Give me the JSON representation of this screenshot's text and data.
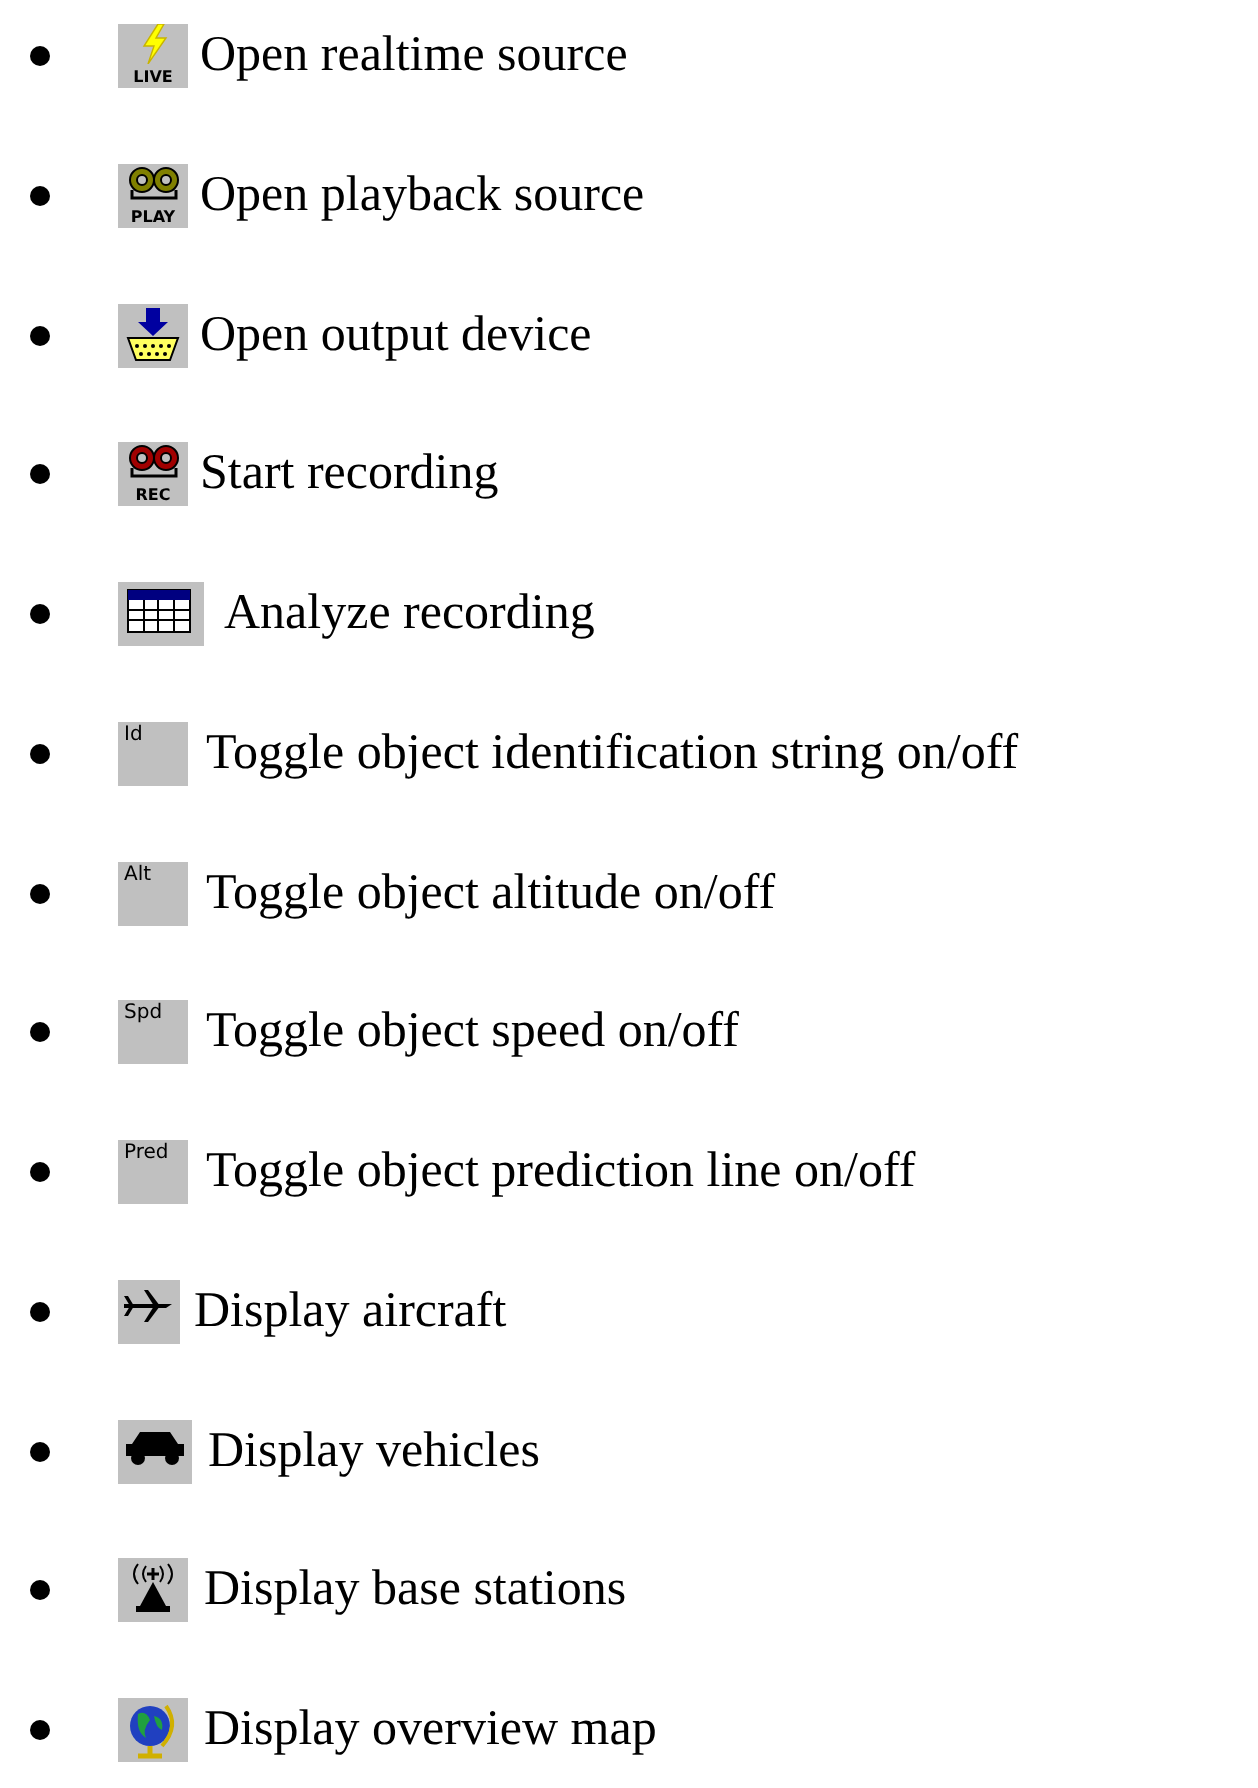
{
  "items": [
    {
      "icon": {
        "kind": "live",
        "label": "LIVE"
      },
      "text": "Open realtime source"
    },
    {
      "icon": {
        "kind": "play",
        "label": "PLAY"
      },
      "text": "Open playback source"
    },
    {
      "icon": {
        "kind": "output"
      },
      "text": "Open output device"
    },
    {
      "icon": {
        "kind": "rec",
        "label": "REC"
      },
      "text": "Start recording"
    },
    {
      "icon": {
        "kind": "table"
      },
      "text": "Analyze recording"
    },
    {
      "icon": {
        "kind": "text",
        "label": "Id"
      },
      "text": "Toggle object identification string on/off"
    },
    {
      "icon": {
        "kind": "text",
        "label": "Alt"
      },
      "text": "Toggle object altitude on/off"
    },
    {
      "icon": {
        "kind": "text",
        "label": "Spd"
      },
      "text": "Toggle object speed on/off"
    },
    {
      "icon": {
        "kind": "text",
        "label": "Pred"
      },
      "text": "Toggle object prediction line on/off"
    },
    {
      "icon": {
        "kind": "aircraft"
      },
      "text": "Display aircraft"
    },
    {
      "icon": {
        "kind": "vehicle"
      },
      "text": "Display vehicles"
    },
    {
      "icon": {
        "kind": "antenna"
      },
      "text": "Display base stations"
    },
    {
      "icon": {
        "kind": "globe"
      },
      "text": "Display overview map"
    }
  ]
}
